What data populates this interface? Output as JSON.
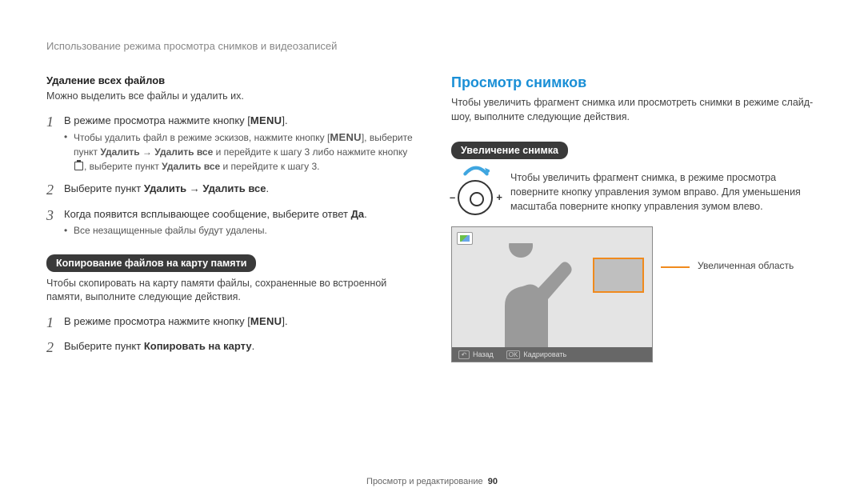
{
  "breadcrumb": "Использование режима просмотра снимков и видеозаписей",
  "left": {
    "delete_all_heading": "Удаление всех файлов",
    "delete_all_intro": "Можно выделить все файлы и удалить их.",
    "step1_prefix": "В режиме просмотра нажмите кнопку [",
    "step1_menu": "MENU",
    "step1_suffix": "].",
    "step1_bullet_a": "Чтобы удалить файл в режиме эскизов, нажмите кнопку [",
    "step1_bullet_a_menu": "MENU",
    "step1_bullet_a_mid": "], выберите пункт ",
    "step1_bullet_a_bold": "Удалить → Удалить все",
    "step1_bullet_a_tail": " и перейдите к шагу 3 либо нажмите кнопку ",
    "step1_bullet_a_tail2": ", выберите пункт ",
    "step1_bullet_a_bold2": "Удалить все",
    "step1_bullet_a_tail3": " и перейдите к шагу 3.",
    "step2_prefix": "Выберите пункт ",
    "step2_bold": "Удалить → Удалить все",
    "step2_suffix": ".",
    "step3_prefix": "Когда появится всплывающее сообщение, выберите ответ ",
    "step3_bold": "Да",
    "step3_suffix": ".",
    "step3_bullet": "Все незащищенные файлы будут удалены.",
    "copy_pill": "Копирование файлов на карту памяти",
    "copy_intro": "Чтобы скопировать на карту памяти файлы, сохраненные во встроенной памяти, выполните следующие действия.",
    "copy_step1_prefix": "В режиме просмотра нажмите кнопку [",
    "copy_step1_menu": "MENU",
    "copy_step1_suffix": "].",
    "copy_step2_prefix": "Выберите пункт ",
    "copy_step2_bold": "Копировать на карту",
    "copy_step2_suffix": "."
  },
  "right": {
    "h2": "Просмотр снимков",
    "intro": "Чтобы увеличить фрагмент снимка или просмотреть снимки в режиме слайд-шоу, выполните следующие действия.",
    "zoom_pill": "Увеличение снимка",
    "zoom_desc": "Чтобы увеличить фрагмент снимка, в режиме просмотра поверните кнопку управления зумом вправо. Для уменьшения масштаба поверните кнопку управления зумом влево.",
    "callout": "Увеличенная область",
    "back_key": "↶",
    "back_label": "Назад",
    "ok_key": "OK",
    "ok_label": "Кадрировать"
  },
  "footer": {
    "section": "Просмотр и редактирование",
    "page": "90"
  },
  "nums": {
    "n1": "1",
    "n2": "2",
    "n3": "3"
  }
}
